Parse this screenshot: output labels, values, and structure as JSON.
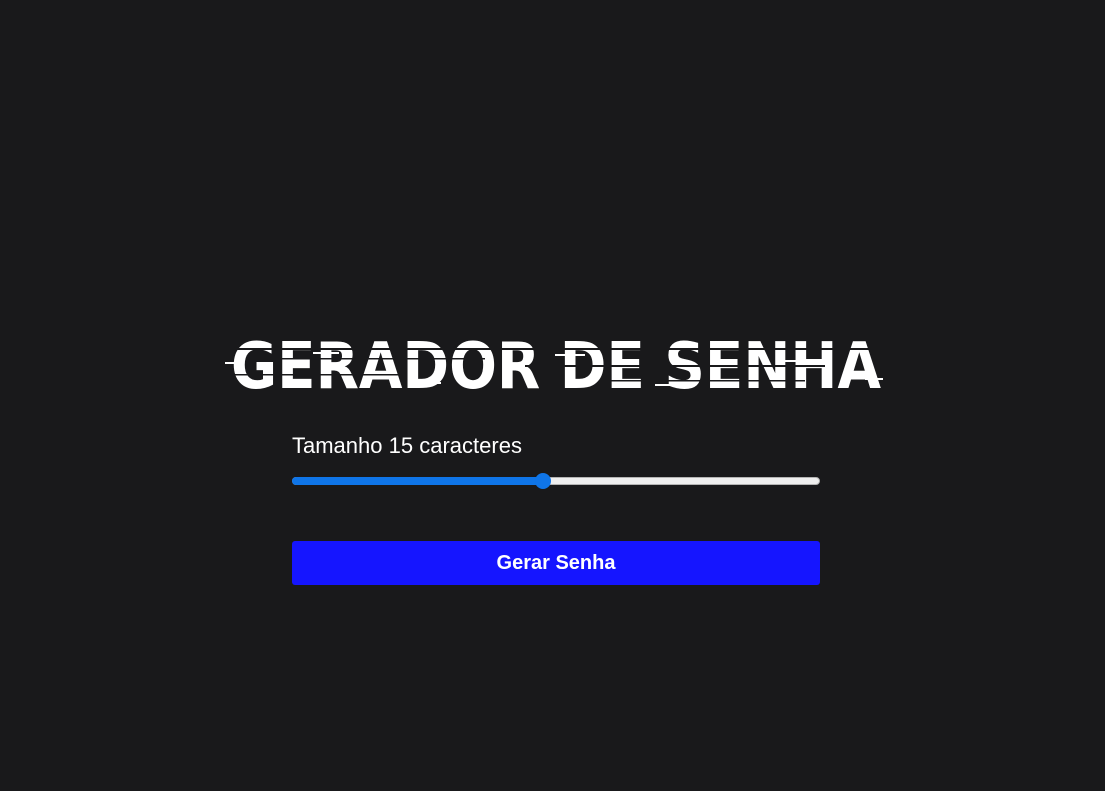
{
  "header": {
    "title": "GERADOR DE SENHA"
  },
  "generator": {
    "size_prefix": "Tamanho",
    "size_value": 15,
    "size_suffix": "caracteres",
    "slider_fraction": 0.475,
    "generate_label": "Gerar Senha"
  },
  "colors": {
    "background": "#19191b",
    "accent": "#0f75e8",
    "button": "#1515ff",
    "text": "#ffffff"
  }
}
